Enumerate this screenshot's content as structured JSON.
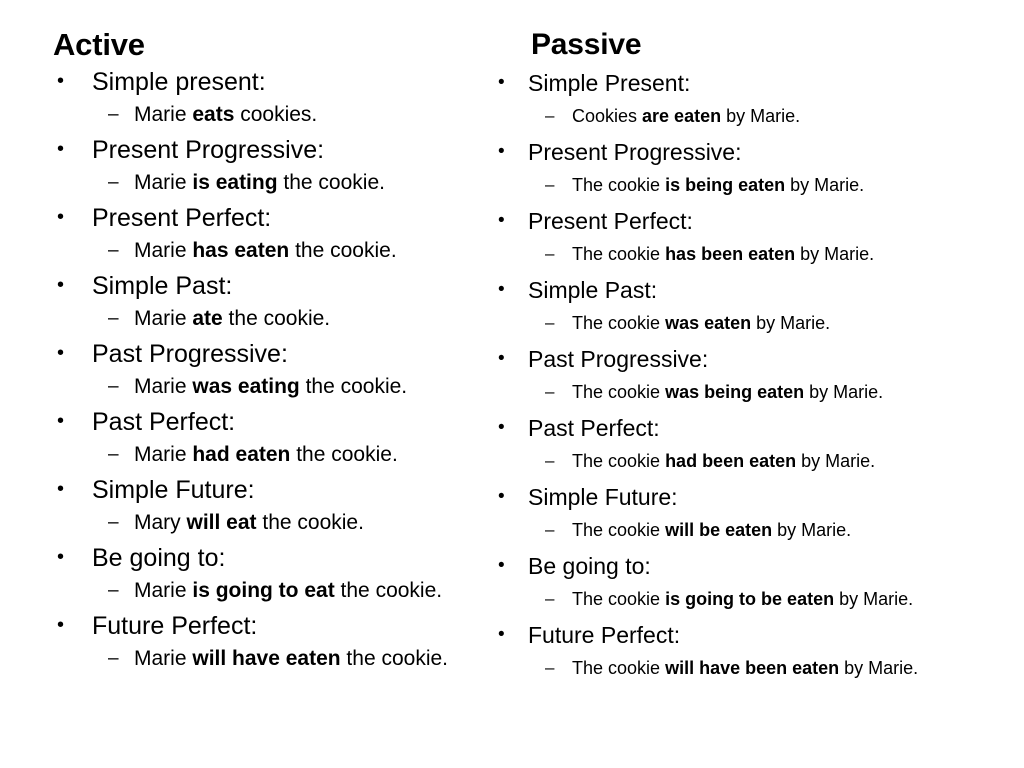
{
  "slide": {
    "background_color": "#ffffff",
    "text_color": "#000000",
    "bullet_glyph": "•",
    "dash_glyph": "–"
  },
  "columns": [
    {
      "id": "active",
      "heading": "Active",
      "items": [
        {
          "label": "Simple present:",
          "example_parts": [
            {
              "text": "Marie ",
              "bold": false
            },
            {
              "text": "eats",
              "bold": true
            },
            {
              "text": " cookies.",
              "bold": false
            }
          ]
        },
        {
          "label": "Present Progressive:",
          "example_parts": [
            {
              "text": "Marie ",
              "bold": false
            },
            {
              "text": "is eating",
              "bold": true
            },
            {
              "text": " the cookie.",
              "bold": false
            }
          ]
        },
        {
          "label": "Present Perfect:",
          "example_parts": [
            {
              "text": "Marie ",
              "bold": false
            },
            {
              "text": "has eaten",
              "bold": true
            },
            {
              "text": " the cookie.",
              "bold": false
            }
          ]
        },
        {
          "label": "Simple Past:",
          "example_parts": [
            {
              "text": "Marie ",
              "bold": false
            },
            {
              "text": "ate",
              "bold": true
            },
            {
              "text": " the cookie.",
              "bold": false
            }
          ]
        },
        {
          "label": "Past Progressive:",
          "example_parts": [
            {
              "text": "Marie ",
              "bold": false
            },
            {
              "text": "was eating",
              "bold": true
            },
            {
              "text": " the cookie.",
              "bold": false
            }
          ]
        },
        {
          "label": "Past Perfect:",
          "example_parts": [
            {
              "text": "Marie ",
              "bold": false
            },
            {
              "text": "had eaten",
              "bold": true
            },
            {
              "text": " the cookie.",
              "bold": false
            }
          ]
        },
        {
          "label": "Simple Future:",
          "example_parts": [
            {
              "text": "Mary ",
              "bold": false
            },
            {
              "text": "will eat",
              "bold": true
            },
            {
              "text": " the cookie.",
              "bold": false
            }
          ]
        },
        {
          "label": "Be going to:",
          "example_parts": [
            {
              "text": "Marie ",
              "bold": false
            },
            {
              "text": "is going to eat",
              "bold": true
            },
            {
              "text": " the cookie.",
              "bold": false
            }
          ]
        },
        {
          "label": "Future Perfect:",
          "example_parts": [
            {
              "text": "Marie ",
              "bold": false
            },
            {
              "text": "will have eaten",
              "bold": true
            },
            {
              "text": " the cookie.",
              "bold": false
            }
          ]
        }
      ]
    },
    {
      "id": "passive",
      "heading": "Passive",
      "items": [
        {
          "label": "Simple Present:",
          "example_parts": [
            {
              "text": "Cookies ",
              "bold": false
            },
            {
              "text": "are eaten",
              "bold": true
            },
            {
              "text": " by Marie.",
              "bold": false
            }
          ]
        },
        {
          "label": "Present Progressive:",
          "example_parts": [
            {
              "text": "The cookie ",
              "bold": false
            },
            {
              "text": "is being eaten",
              "bold": true
            },
            {
              "text": " by Marie.",
              "bold": false
            }
          ]
        },
        {
          "label": "Present Perfect:",
          "example_parts": [
            {
              "text": "The cookie ",
              "bold": false
            },
            {
              "text": "has been eaten",
              "bold": true
            },
            {
              "text": " by Marie.",
              "bold": false
            }
          ]
        },
        {
          "label": "Simple Past:",
          "example_parts": [
            {
              "text": "The cookie ",
              "bold": false
            },
            {
              "text": "was eaten",
              "bold": true
            },
            {
              "text": " by Marie.",
              "bold": false
            }
          ]
        },
        {
          "label": "Past Progressive:",
          "example_parts": [
            {
              "text": "The cookie ",
              "bold": false
            },
            {
              "text": "was being eaten",
              "bold": true
            },
            {
              "text": " by Marie.",
              "bold": false
            }
          ]
        },
        {
          "label": "Past Perfect:",
          "example_parts": [
            {
              "text": "The cookie ",
              "bold": false
            },
            {
              "text": "had been eaten",
              "bold": true
            },
            {
              "text": " by Marie.",
              "bold": false
            }
          ]
        },
        {
          "label": "Simple Future:",
          "example_parts": [
            {
              "text": "The cookie ",
              "bold": false
            },
            {
              "text": "will be eaten",
              "bold": true
            },
            {
              "text": " by Marie.",
              "bold": false
            }
          ]
        },
        {
          "label": "Be going to:",
          "example_parts": [
            {
              "text": "The cookie ",
              "bold": false
            },
            {
              "text": "is going to be eaten",
              "bold": true
            },
            {
              "text": " by Marie.",
              "bold": false
            }
          ]
        },
        {
          "label": "Future Perfect:",
          "example_parts": [
            {
              "text": "The cookie ",
              "bold": false
            },
            {
              "text": "will have been eaten",
              "bold": true
            },
            {
              "text": " by Marie.",
              "bold": false
            }
          ]
        }
      ]
    }
  ]
}
